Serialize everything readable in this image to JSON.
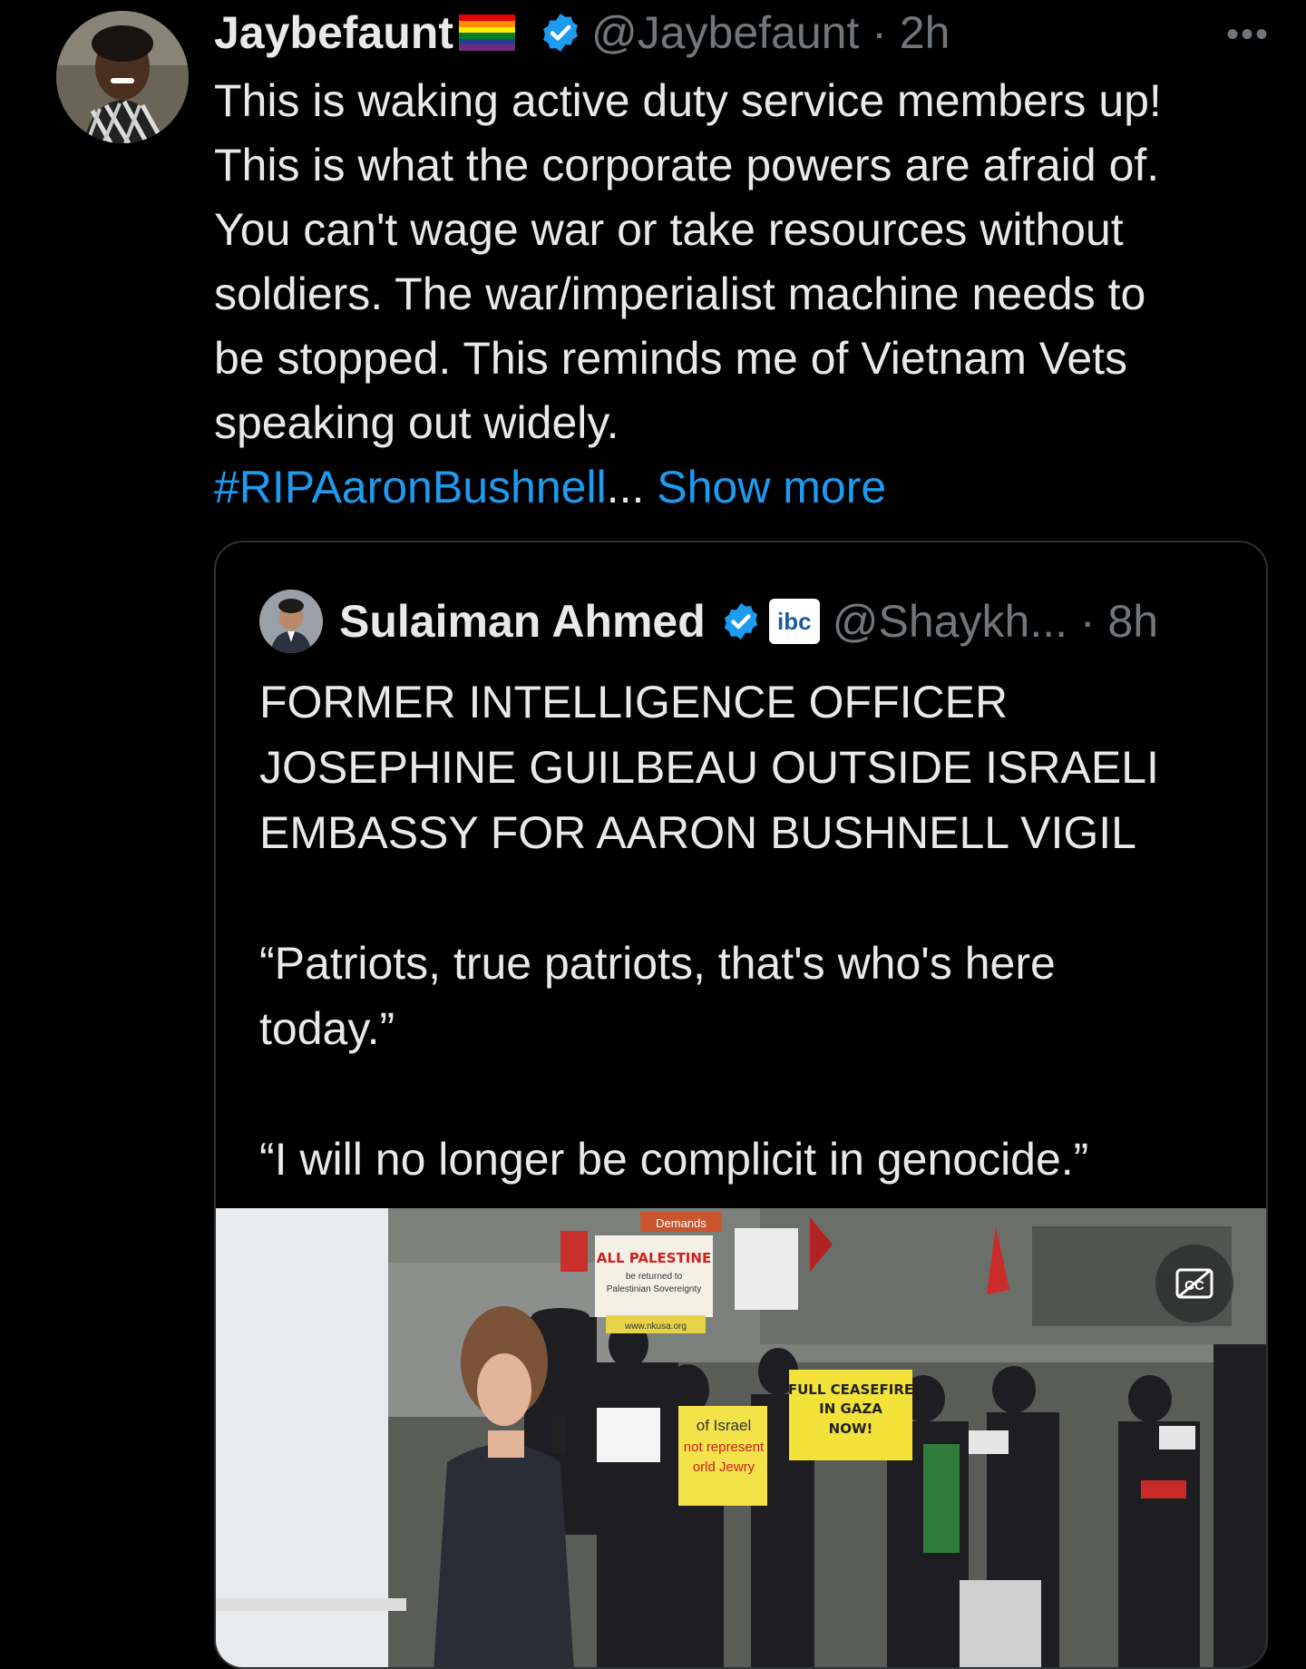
{
  "tweet": {
    "display_name": "Jaybefaunt",
    "handle_time": "@Jaybefaunt · 2h",
    "more_label": "•••",
    "lines": [
      "This is waking active duty service members up!",
      "This is what the corporate powers are afraid of.",
      "You can't wage war or take resources without",
      "soldiers. The war/imperialist machine needs to",
      "be stopped. This reminds me of Vietnam Vets",
      "speaking out widely."
    ],
    "hashtag": "#RIPAaronBushnell",
    "ellipsis": "...",
    "show_more": "Show more"
  },
  "quoted": {
    "display_name": "Sulaiman Ahmed",
    "badge_text": "ibc",
    "handle_time": "@Shaykh... · 8h",
    "lines": [
      "FORMER INTELLIGENCE OFFICER",
      "JOSEPHINE GUILBEAU OUTSIDE ISRAELI",
      "EMBASSY FOR AARON BUSHNELL VIGIL"
    ],
    "quote1_lines": [
      "“Patriots, true patriots, that's who's here",
      "today.”"
    ],
    "quote2": "“I will no longer be complicit in genocide.”"
  },
  "media": {
    "cc_label": "CC",
    "signs": {
      "demands": "Demands",
      "all_palestine": "ALL PALESTINE",
      "returned_to": "be returned to",
      "sovereignty": "Palestinian Sovereignty",
      "nkusa": "www.nkusa.org",
      "ceasefire_1": "FULL CEASEFIRE",
      "ceasefire_2": "IN GAZA",
      "ceasefire_3": "NOW!",
      "israel_1": "of Israel",
      "israel_2": "not represent",
      "israel_3": "orld Jewry"
    }
  },
  "colors": {
    "background": "#000000",
    "text": "#e7e9ea",
    "secondary": "#71767b",
    "link": "#1d9bf0",
    "border": "#2f3336"
  }
}
